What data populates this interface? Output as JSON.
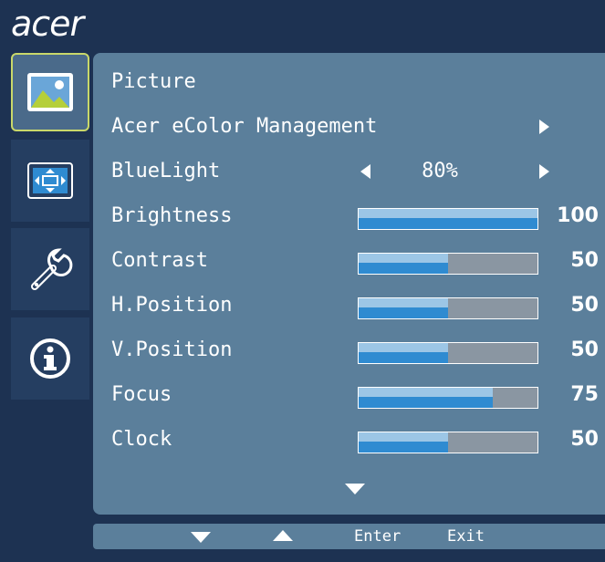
{
  "brand": {
    "logo_text": "acer"
  },
  "sidebar": {
    "items": [
      {
        "icon": "picture-icon",
        "active": true
      },
      {
        "icon": "display-position-icon",
        "active": false
      },
      {
        "icon": "settings-tools-icon",
        "active": false
      },
      {
        "icon": "info-icon",
        "active": false
      }
    ]
  },
  "menu": {
    "title": "Picture",
    "ecolor": {
      "label": "Acer eColor Management"
    },
    "bluelight": {
      "label": "BlueLight",
      "value": "80%"
    },
    "sliders": [
      {
        "label": "Brightness",
        "value": 100,
        "value_text": "100"
      },
      {
        "label": "Contrast",
        "value": 50,
        "value_text": "50"
      },
      {
        "label": "H.Position",
        "value": 50,
        "value_text": "50"
      },
      {
        "label": "V.Position",
        "value": 50,
        "value_text": "50"
      },
      {
        "label": "Focus",
        "value": 75,
        "value_text": "75"
      },
      {
        "label": "Clock",
        "value": 50,
        "value_text": "50"
      }
    ]
  },
  "footer": {
    "enter_label": "Enter",
    "exit_label": "Exit"
  },
  "colors": {
    "background": "#1d3252",
    "panel": "#5b7f9b",
    "active_border": "#c9d86a",
    "bar_fill": "#2f8bd1"
  }
}
